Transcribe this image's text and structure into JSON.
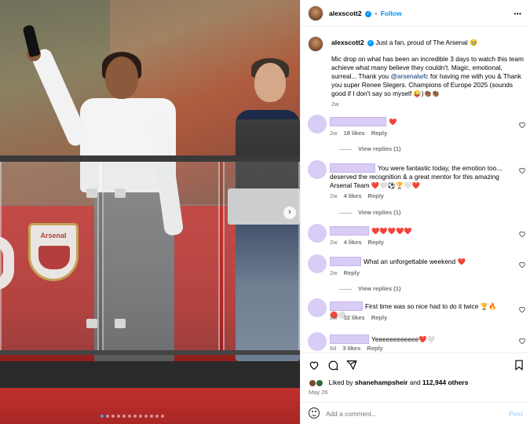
{
  "post": {
    "username": "alexscott2",
    "follow_label": "Follow",
    "caption_line1": "Just a fan, proud of The Arsenal 🥹",
    "caption_body_pre": "Mic drop on what has been an incredible 3 days to watch this team achieve what many believe they couldn't. Magic, emotional, surreal... Thank you ",
    "caption_mention": "@arsenalwfc",
    "caption_body_post": " for having me with you & Thank you super Renee Slegers. Champions of Europe 2025 (sounds good if I don't say so myself 😜)👏🏾👏🏾",
    "caption_age": "2w",
    "photo_crest_text": "Arsenal",
    "carousel": {
      "slide_count": 12,
      "active_index": 0
    }
  },
  "comments": [
    {
      "text": "❤️",
      "age": "2w",
      "likes": "18 likes",
      "reply": "Reply",
      "view_replies": "View replies (1)"
    },
    {
      "text": "You were fantastic today, the emotion too.., deserved the recognition & a great mentor for this amazing Arsenal Team ❤️🤍⚽🏆🤍❤️",
      "age": "2w",
      "likes": "4 likes",
      "reply": "Reply",
      "view_replies": "View replies (1)"
    },
    {
      "text": "❤️❤️❤️❤️❤️",
      "age": "2w",
      "likes": "4 likes",
      "reply": "Reply",
      "view_replies": ""
    },
    {
      "text": "What an unforgettable weekend ❤️",
      "age": "2w",
      "likes": "",
      "reply": "Reply",
      "view_replies": "View replies (1)"
    },
    {
      "text": "First time was so nice had to do it twice 🏆🔥🔴⚪",
      "age": "2w",
      "likes": "32 likes",
      "reply": "Reply",
      "view_replies": ""
    },
    {
      "text": "Yeeeeeeeeeeee❤️🤍",
      "age": "6d",
      "likes": "3 likes",
      "reply": "Reply",
      "view_replies": ""
    }
  ],
  "footer": {
    "liked_by_prefix": "Liked by ",
    "liked_by_user": "shanehampsheir",
    "liked_by_and": " and ",
    "liked_by_count": "112,944 others",
    "date": "May 26",
    "comment_placeholder": "Add a comment...",
    "post_label": "Post"
  },
  "icons": {
    "like": "heart-icon",
    "comment": "comment-icon",
    "share": "share-icon",
    "save": "bookmark-icon",
    "more": "more-options-icon",
    "emoji": "emoji-icon",
    "next": "chevron-right-icon"
  },
  "colors": {
    "accent": "#0095f6",
    "mention": "#00376b",
    "heart": "#ed4956",
    "redacted": "#d9ccf5"
  }
}
